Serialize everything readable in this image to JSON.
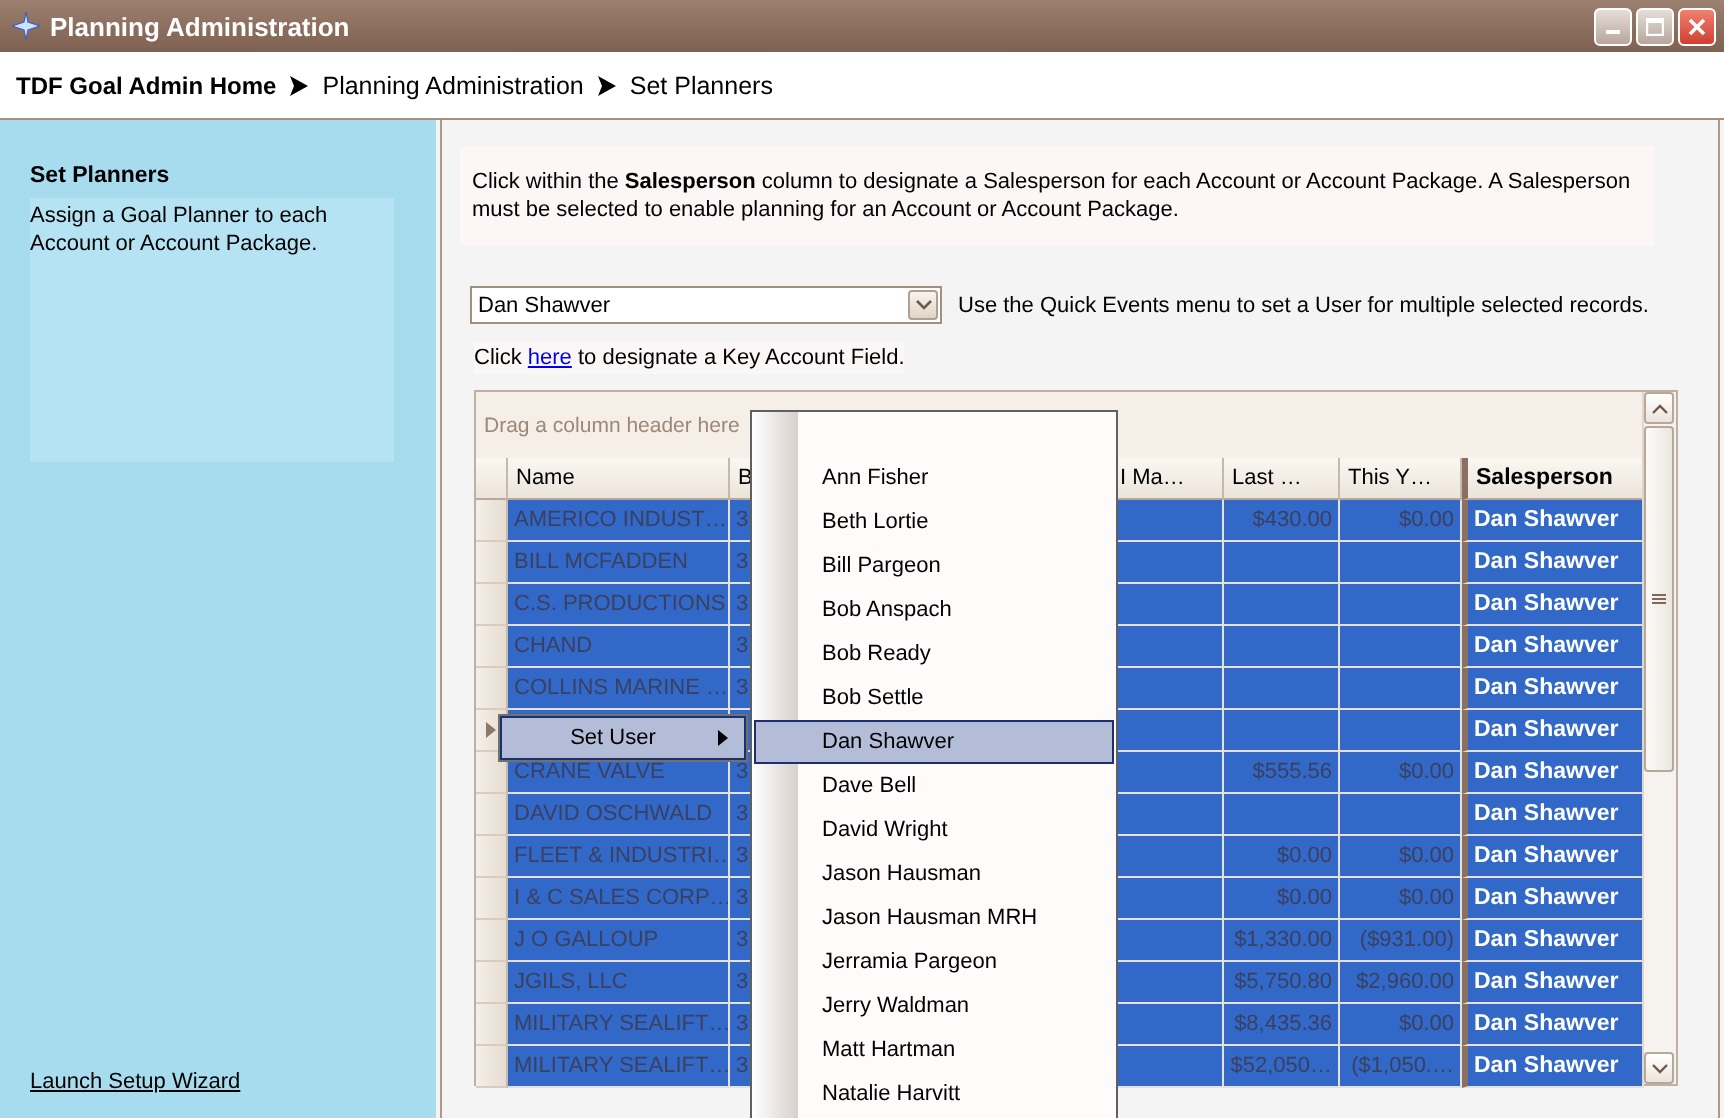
{
  "window": {
    "title": "Planning Administration"
  },
  "breadcrumb": [
    {
      "label": "TDF Goal Admin Home",
      "kind": "home"
    },
    {
      "label": "Planning Administration",
      "kind": "page"
    },
    {
      "label": "Set Planners",
      "kind": "page"
    }
  ],
  "sidebar": {
    "title": "Set Planners",
    "description": "Assign a Goal Planner to each Account or Account Package.",
    "link": "Launch Setup Wizard"
  },
  "instructions": "Click within the **Salesperson** column to designate a Salesperson for each Account or Account Package.  A Salesperson must be selected to enable planning for an Account or Account Package.",
  "user_dropdown": {
    "value": "Dan Shawver"
  },
  "quick_events_hint": "Use the Quick Events menu to set a User for multiple selected records.",
  "key_account": {
    "before": "Click ",
    "link": "here",
    "after": " to designate a Key Account Field."
  },
  "grid": {
    "group_hint": "Drag a column header here",
    "columns": [
      {
        "label": "Name"
      },
      {
        "label": "B"
      },
      {
        "label": "I Ma…"
      },
      {
        "label": "Last …"
      },
      {
        "label": "This Y…"
      },
      {
        "label": "Salesperson"
      }
    ],
    "rows": [
      {
        "selected": true,
        "current": false,
        "name": "AMERICO INDUST…",
        "column_2": "3",
        "last": "$430.00",
        "this_year": "$0.00",
        "salesperson": "Dan Shawver"
      },
      {
        "selected": true,
        "current": false,
        "name": "BILL MCFADDEN",
        "column_2": "3",
        "salesperson": "Dan Shawver"
      },
      {
        "selected": true,
        "current": false,
        "name": "C.S. PRODUCTIONS",
        "column_2": "3",
        "salesperson": "Dan Shawver"
      },
      {
        "selected": true,
        "current": false,
        "name": "CHAND",
        "column_2": "3",
        "salesperson": "Dan Shawver"
      },
      {
        "selected": true,
        "current": false,
        "name": "COLLINS MARINE …",
        "column_2": "3",
        "salesperson": "Dan Shawver"
      },
      {
        "selected": true,
        "current": true,
        "salesperson": "Dan Shawver"
      },
      {
        "selected": true,
        "current": false,
        "name": "CRANE VALVE",
        "column_2": "3",
        "last": "$555.56",
        "this_year": "$0.00",
        "salesperson": "Dan Shawver"
      },
      {
        "selected": true,
        "current": false,
        "name": "DAVID OSCHWALD",
        "column_2": "3",
        "salesperson": "Dan Shawver"
      },
      {
        "selected": true,
        "current": false,
        "name": "FLEET & INDUSTRI…",
        "column_2": "3",
        "last": "$0.00",
        "this_year": "$0.00",
        "salesperson": "Dan Shawver"
      },
      {
        "selected": true,
        "current": false,
        "name": "I & C SALES CORP…",
        "column_2": "3",
        "last": "$0.00",
        "this_year": "$0.00",
        "salesperson": "Dan Shawver"
      },
      {
        "selected": true,
        "current": false,
        "name": "J O GALLOUP",
        "column_2": "3",
        "last": "$1,330.00",
        "this_year": "($931.00)",
        "salesperson": "Dan Shawver"
      },
      {
        "selected": true,
        "current": false,
        "name": "JGILS, LLC",
        "column_2": "3",
        "last": "$5,750.80",
        "this_year": "$2,960.00",
        "salesperson": "Dan Shawver"
      },
      {
        "selected": true,
        "current": false,
        "name": "MILITARY SEALIFT…",
        "column_2": "3",
        "last": "$8,435.36",
        "this_year": "$0.00",
        "salesperson": "Dan Shawver"
      },
      {
        "selected": true,
        "current": false,
        "name": "MILITARY SEALIFT…",
        "column_2": "3",
        "last": "$52,050…",
        "this_year": "($1,050.…",
        "salesperson": "Dan Shawver"
      }
    ]
  },
  "context_menu": {
    "items": [
      {
        "label": "Set User",
        "selected": true,
        "has_submenu": true
      }
    ]
  },
  "user_submenu": {
    "items": [
      {
        "label": "Ann Fisher",
        "selected": false
      },
      {
        "label": "Beth Lortie",
        "selected": false
      },
      {
        "label": "Bill Pargeon",
        "selected": false
      },
      {
        "label": "Bob Anspach",
        "selected": false
      },
      {
        "label": "Bob Ready",
        "selected": false
      },
      {
        "label": "Bob Settle",
        "selected": false
      },
      {
        "label": "Dan Shawver",
        "selected": true
      },
      {
        "label": "Dave Bell",
        "selected": false
      },
      {
        "label": "David Wright",
        "selected": false
      },
      {
        "label": "Jason Hausman",
        "selected": false
      },
      {
        "label": "Jason Hausman MRH",
        "selected": false
      },
      {
        "label": "Jerramia Pargeon",
        "selected": false
      },
      {
        "label": "Jerry Waldman",
        "selected": false
      },
      {
        "label": "Matt Hartman",
        "selected": false
      },
      {
        "label": "Natalie Harvitt",
        "selected": false
      }
    ]
  }
}
